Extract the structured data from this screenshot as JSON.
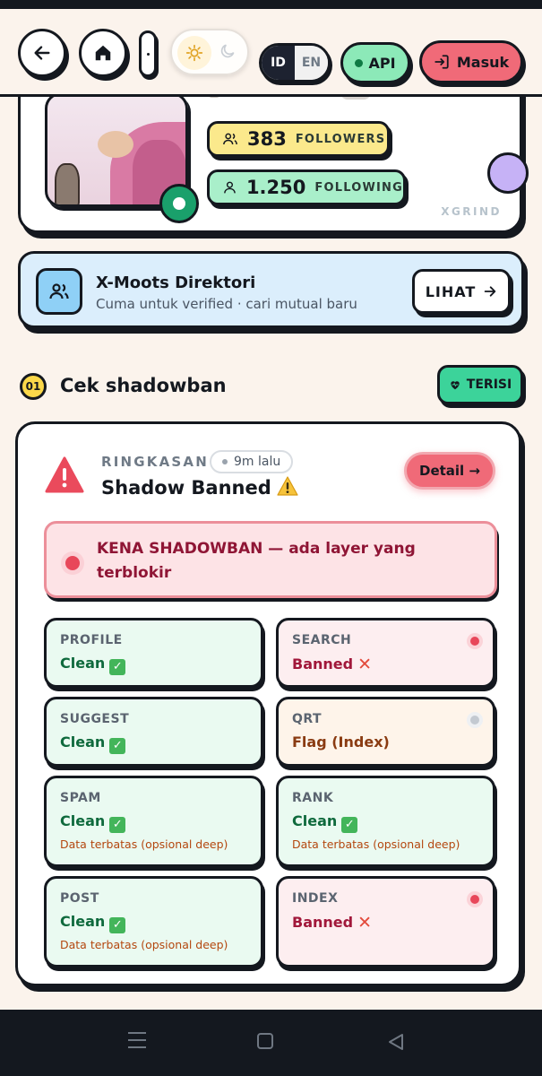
{
  "nav": {
    "theme": {
      "light_icon": "sun-icon",
      "dark_icon": "moon-icon"
    },
    "lang": {
      "active": "ID",
      "inactive": "EN"
    },
    "api_label": "API",
    "login_label": "Masuk"
  },
  "profile": {
    "followers_count": "383",
    "followers_label": "FOLLOWERS",
    "following_count": "1.250",
    "following_label": "FOLLOWING",
    "watermark": "XGRIND"
  },
  "directory": {
    "title": "X-Moots Direktori",
    "subtitle": "Cuma untuk verified · cari mutual baru",
    "button_label": "LIHAT"
  },
  "section": {
    "number": "01",
    "title": "Cek shadowban",
    "badge_label": "TERISI"
  },
  "summary": {
    "label": "RINGKASAN",
    "time": "9m lalu",
    "status": "Shadow Banned",
    "detail_label": "Detail →",
    "alert_text": "KENA SHADOWBAN — ada layer yang terblokir"
  },
  "checks": [
    {
      "label": "PROFILE",
      "value": "Clean",
      "state": "ok",
      "note": "",
      "dot": ""
    },
    {
      "label": "SEARCH",
      "value": "Banned",
      "state": "bad",
      "note": "",
      "dot": "red"
    },
    {
      "label": "SUGGEST",
      "value": "Clean",
      "state": "ok",
      "note": "",
      "dot": ""
    },
    {
      "label": "QRT",
      "value": "Flag (Index)",
      "state": "flag",
      "note": "",
      "dot": "grey"
    },
    {
      "label": "SPAM",
      "value": "Clean",
      "state": "ok",
      "note": "Data terbatas (opsional deep)",
      "dot": ""
    },
    {
      "label": "RANK",
      "value": "Clean",
      "state": "ok",
      "note": "Data terbatas (opsional deep)",
      "dot": ""
    },
    {
      "label": "POST",
      "value": "Clean",
      "state": "ok",
      "note": "Data terbatas (opsional deep)",
      "dot": ""
    },
    {
      "label": "INDEX",
      "value": "Banned",
      "state": "bad",
      "note": "",
      "dot": "red"
    }
  ],
  "colors": {
    "ink": "#14181f",
    "page_bg": "#fbf3ec",
    "followers_bg": "#fbe98c",
    "following_bg": "#a9efca",
    "api_bg": "#8ce9b8",
    "login_bg": "#f06a78",
    "clean": "#0f6a3d",
    "banned": "#a1173a",
    "alert_bg": "#fde3e6"
  }
}
